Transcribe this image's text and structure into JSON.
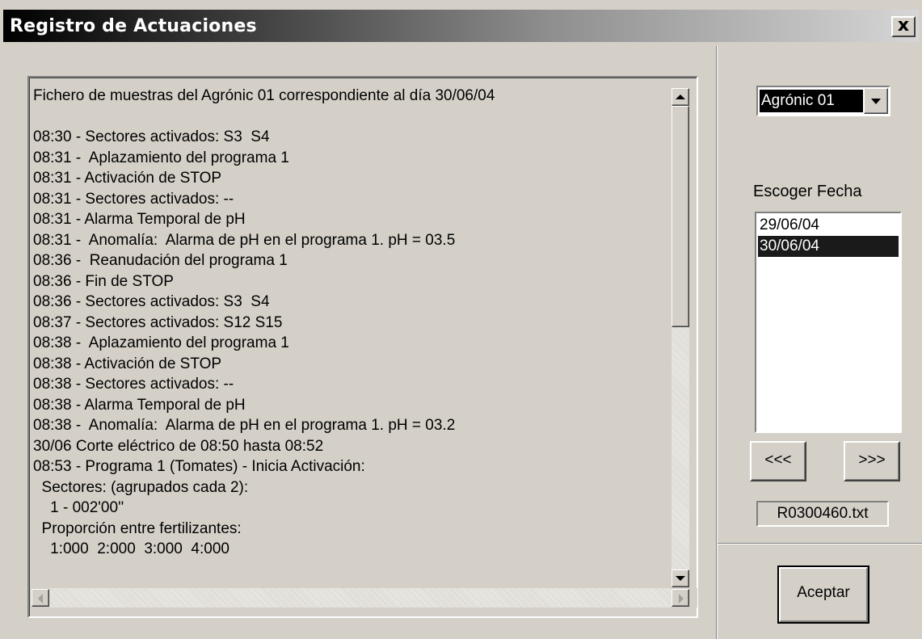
{
  "window": {
    "title": "Registro de Actuaciones",
    "close_label": "x"
  },
  "log_lines": [
    "Fichero de muestras del Agrónic 01 correspondiente al día 30/06/04",
    "",
    "08:30 - Sectores activados: S3  S4",
    "08:31 -  Aplazamiento del programa 1",
    "08:31 - Activación de STOP",
    "08:31 - Sectores activados: --",
    "08:31 - Alarma Temporal de pH",
    "08:31 -  Anomalía:  Alarma de pH en el programa 1. pH = 03.5",
    "08:36 -  Reanudación del programa 1",
    "08:36 - Fin de STOP",
    "08:36 - Sectores activados: S3  S4",
    "08:37 - Sectores activados: S12 S15",
    "08:38 -  Aplazamiento del programa 1",
    "08:38 - Activación de STOP",
    "08:38 - Sectores activados: --",
    "08:38 - Alarma Temporal de pH",
    "08:38 -  Anomalía:  Alarma de pH en el programa 1. pH = 03.2",
    "30/06 Corte eléctrico de 08:50 hasta 08:52",
    "08:53 - Programa 1 (Tomates) - Inicia Activación:",
    "  Sectores: (agrupados cada 2):",
    "    1 - 002'00''",
    "  Proporción entre fertilizantes:",
    "    1:000  2:000  3:000  4:000"
  ],
  "device_select": {
    "value": "Agrónic 01"
  },
  "date_picker": {
    "label": "Escoger Fecha",
    "dates": [
      "29/06/04",
      "30/06/04"
    ],
    "selected": "30/06/04"
  },
  "nav": {
    "prev_label": "<<<",
    "next_label": ">>>"
  },
  "file": {
    "name": "R0300460.txt"
  },
  "actions": {
    "ok_label": "Aceptar"
  }
}
